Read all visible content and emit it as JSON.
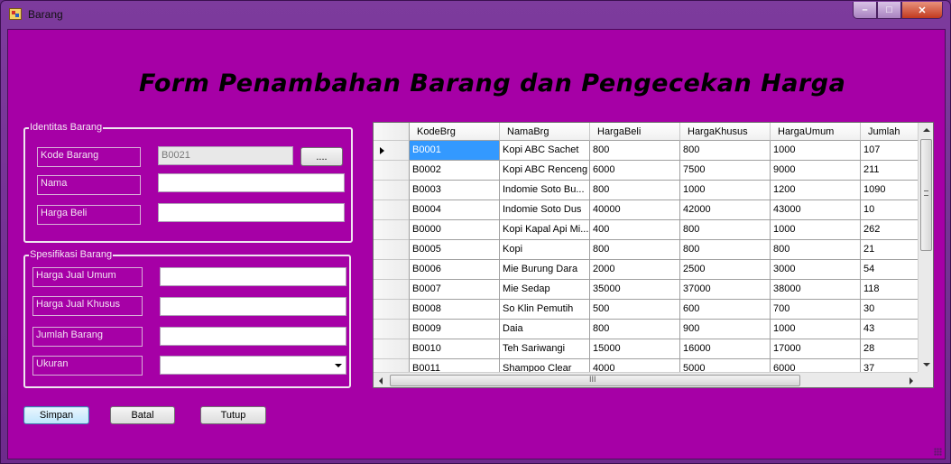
{
  "window": {
    "title": "Barang"
  },
  "heading": "Form Penambahan Barang dan Pengecekan Harga",
  "identitas": {
    "legend": "Identitas Barang",
    "kode_label": "Kode Barang",
    "kode_value": "B0021",
    "browse_label": "....",
    "nama_label": "Nama",
    "nama_value": "",
    "harga_beli_label": "Harga Beli",
    "harga_beli_value": ""
  },
  "spesifikasi": {
    "legend": "Spesifikasi Barang",
    "hju_label": "Harga Jual Umum",
    "hju_value": "",
    "hjk_label": "Harga Jual Khusus",
    "hjk_value": "",
    "jumlah_label": "Jumlah Barang",
    "jumlah_value": "",
    "ukuran_label": "Ukuran",
    "ukuran_value": ""
  },
  "buttons": {
    "simpan": "Simpan",
    "batal": "Batal",
    "tutup": "Tutup"
  },
  "grid": {
    "columns": [
      "KodeBrg",
      "NamaBrg",
      "HargaBeli",
      "HargaKhusus",
      "HargaUmum",
      "Jumlah"
    ],
    "rows": [
      [
        "B0001",
        "Kopi ABC Sachet",
        "800",
        "800",
        "1000",
        "107"
      ],
      [
        "B0002",
        "Kopi ABC Renceng",
        "6000",
        "7500",
        "9000",
        "211"
      ],
      [
        "B0003",
        "Indomie Soto Bu...",
        "800",
        "1000",
        "1200",
        "1090"
      ],
      [
        "B0004",
        "Indomie Soto Dus",
        "40000",
        "42000",
        "43000",
        "10"
      ],
      [
        "B0000",
        "Kopi Kapal Api Mi...",
        "400",
        "800",
        "1000",
        "262"
      ],
      [
        "B0005",
        "Kopi",
        "800",
        "800",
        "800",
        "21"
      ],
      [
        "B0006",
        "Mie Burung Dara",
        "2000",
        "2500",
        "3000",
        "54"
      ],
      [
        "B0007",
        "Mie Sedap",
        "35000",
        "37000",
        "38000",
        "118"
      ],
      [
        "B0008",
        "So Klin Pemutih",
        "500",
        "600",
        "700",
        "30"
      ],
      [
        "B0009",
        "Daia",
        "800",
        "900",
        "1000",
        "43"
      ],
      [
        "B0010",
        "Teh Sariwangi",
        "15000",
        "16000",
        "17000",
        "28"
      ],
      [
        "B0011",
        "Shampoo Clear",
        "4000",
        "5000",
        "6000",
        "37"
      ]
    ],
    "selected_row": 0,
    "hscroll_label": "III"
  },
  "colors": {
    "form_bg": "#a600a6",
    "selection": "#3399ff"
  }
}
